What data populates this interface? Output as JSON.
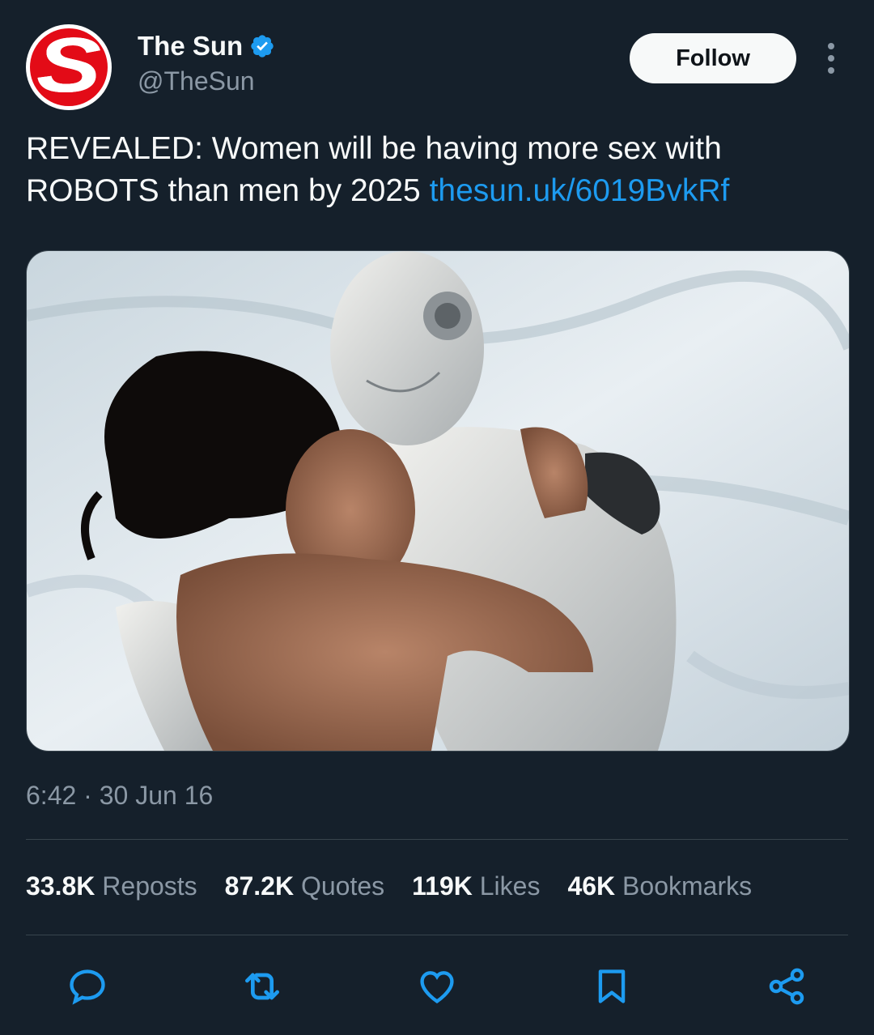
{
  "account": {
    "display_name": "The Sun",
    "handle": "@TheSun",
    "avatar_letter": "S",
    "verified_icon": "verified-badge-icon",
    "brand_color": "#e30b17",
    "verified_color": "#1d9bf0"
  },
  "header": {
    "follow_label": "Follow",
    "more_icon": "more-vertical-icon"
  },
  "tweet": {
    "text": "REVEALED: Women will be having more sex with ROBOTS than men by 2025 ",
    "link_text": "thesun.uk/6019BvkRf",
    "link_color": "#1d9bf0",
    "timestamp": "6:42 · 30 Jun 16"
  },
  "media": {
    "description_icon": "photo-robot-and-woman-in-bed"
  },
  "stats": [
    {
      "value": "33.8K",
      "label": "Reposts"
    },
    {
      "value": "87.2K",
      "label": "Quotes"
    },
    {
      "value": "119K",
      "label": "Likes"
    },
    {
      "value": "46K",
      "label": "Bookmarks"
    }
  ],
  "actions": [
    {
      "icon": "reply-icon"
    },
    {
      "icon": "repost-icon"
    },
    {
      "icon": "like-icon"
    },
    {
      "icon": "bookmark-icon"
    },
    {
      "icon": "share-icon"
    }
  ],
  "colors": {
    "background": "#15202b",
    "divider": "#38444d",
    "secondary_text": "#8b98a5"
  }
}
